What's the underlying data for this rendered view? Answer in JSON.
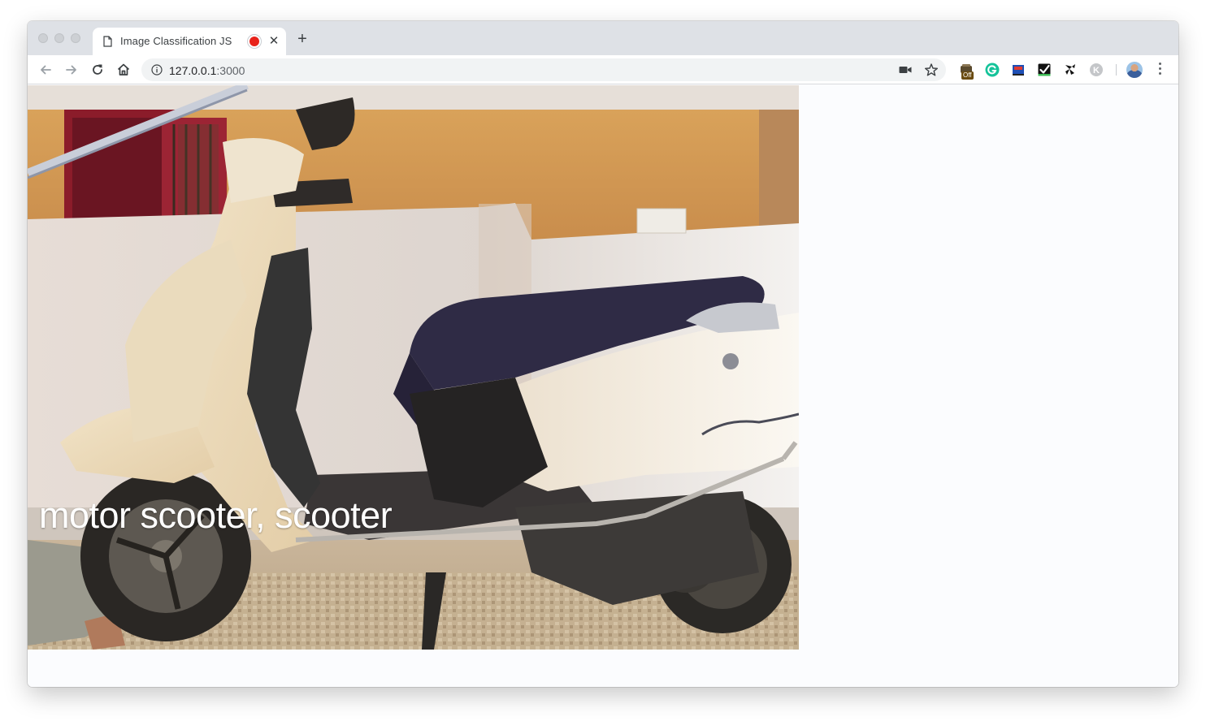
{
  "window": {
    "traffic_lights": [
      "close",
      "minimize",
      "zoom"
    ]
  },
  "tab": {
    "title": "Image Classification JS",
    "icons": {
      "page": "document-icon",
      "recording": "record-icon",
      "close": "close-icon",
      "new_tab": "plus-icon"
    },
    "record_color": "#e8231b"
  },
  "toolbar": {
    "buttons": [
      "back",
      "forward",
      "reload",
      "home"
    ],
    "url": {
      "host": "127.0.0.1",
      "port": ":3000"
    },
    "omnibox_icons": [
      "info-icon",
      "camera-icon",
      "star-icon"
    ],
    "extensions": [
      {
        "name": "camera-off-extension",
        "badge": "Off"
      },
      {
        "name": "grammarly-extension"
      },
      {
        "name": "screen-extension"
      },
      {
        "name": "checkbox-extension"
      },
      {
        "name": "pinwheel-extension"
      },
      {
        "name": "k-extension",
        "letter": "K"
      }
    ],
    "profile": "avatar",
    "menu": "kebab-menu"
  },
  "page": {
    "webcam_subject": "scooter",
    "prediction": "motor scooter, scooter"
  },
  "colors": {
    "tabstrip_bg": "#dee1e6",
    "omnibox_bg": "#f1f3f4",
    "page_bg": "#fbfcfe",
    "prediction_text": "#ffffff"
  }
}
